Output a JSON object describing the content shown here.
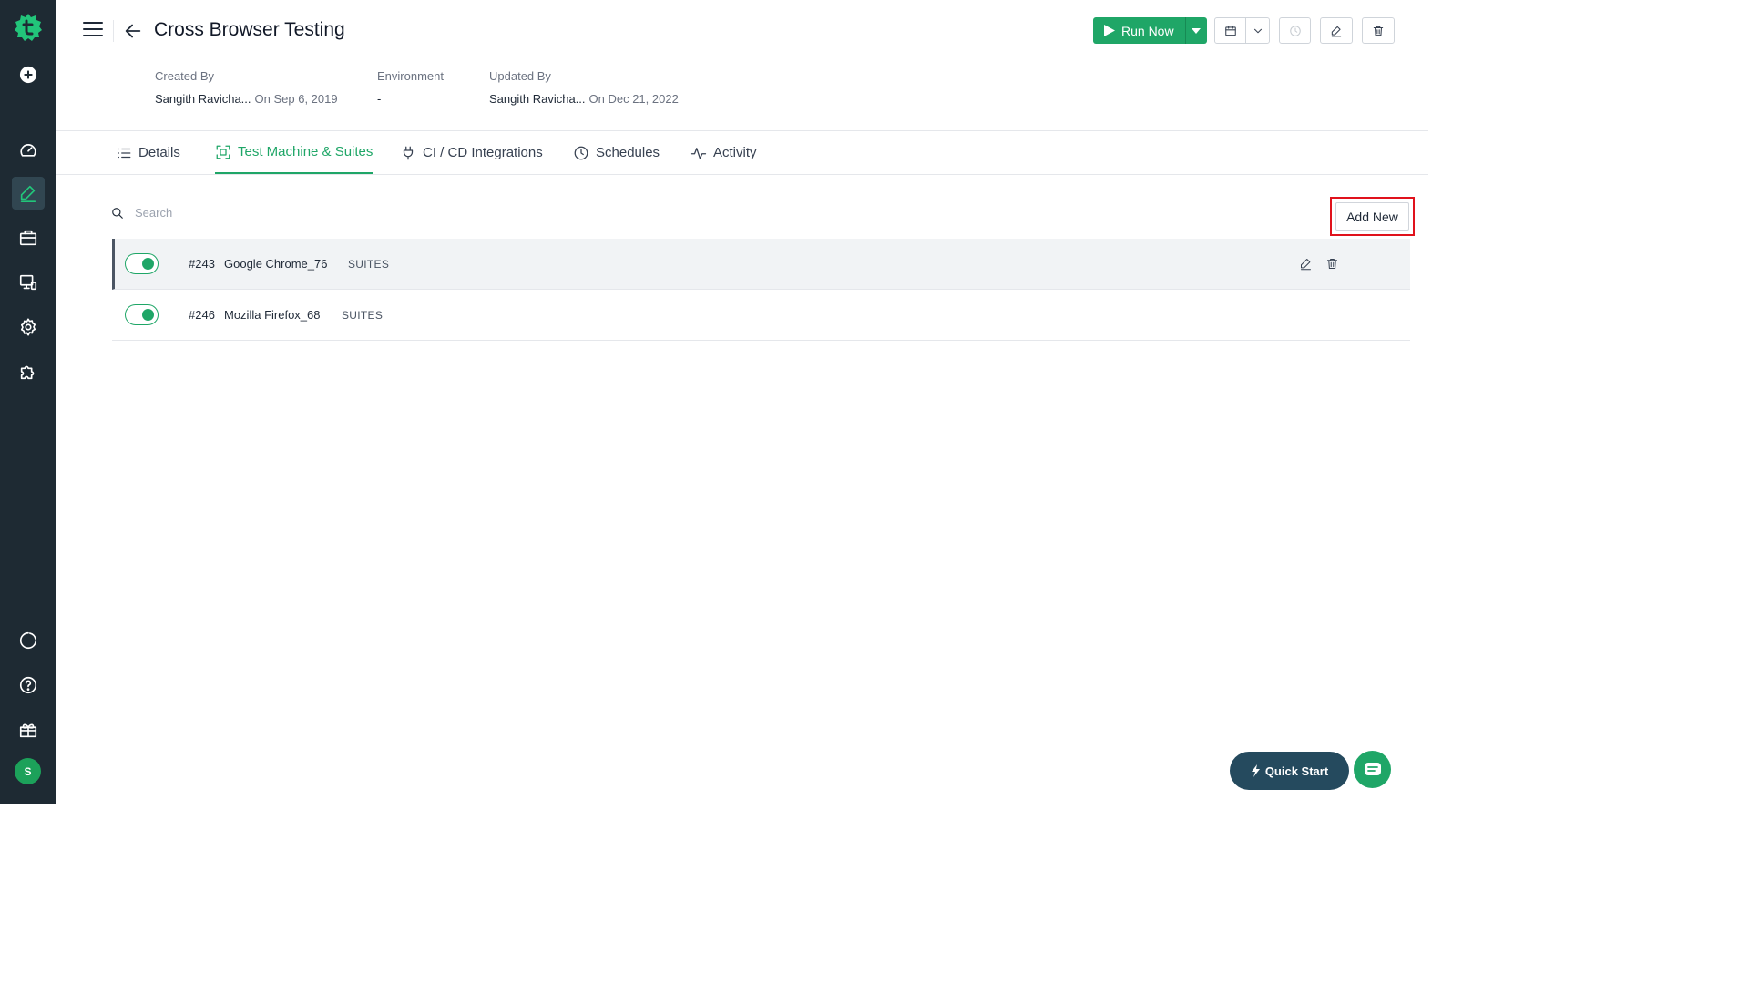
{
  "header": {
    "title": "Cross Browser Testing",
    "created_by_label": "Created By",
    "created_by_name": "Sangith Ravicha...",
    "created_on": "On Sep 6, 2019",
    "environment_label": "Environment",
    "environment_value": "-",
    "updated_by_label": "Updated By",
    "updated_by_name": "Sangith Ravicha...",
    "updated_on": "On Dec 21, 2022",
    "run_now_label": "Run Now"
  },
  "tabs": [
    {
      "label": "Details",
      "icon": "list-icon"
    },
    {
      "label": "Test Machine & Suites",
      "icon": "machine-icon",
      "active": true
    },
    {
      "label": "CI / CD Integrations",
      "icon": "plug-icon"
    },
    {
      "label": "Schedules",
      "icon": "clock-icon"
    },
    {
      "label": "Activity",
      "icon": "activity-icon"
    }
  ],
  "search": {
    "placeholder": "Search"
  },
  "add_new_label": "Add New",
  "rows": [
    {
      "id": "#243",
      "name": "Google Chrome_76",
      "tag": "SUITES",
      "enabled": true
    },
    {
      "id": "#246",
      "name": "Mozilla Firefox_68",
      "tag": "SUITES",
      "enabled": true
    }
  ],
  "user_initial": "S",
  "quick_start_label": "Quick Start",
  "colors": {
    "accent": "#1fa667",
    "sidebar": "#1e2a33",
    "highlight": "#e0121c"
  }
}
